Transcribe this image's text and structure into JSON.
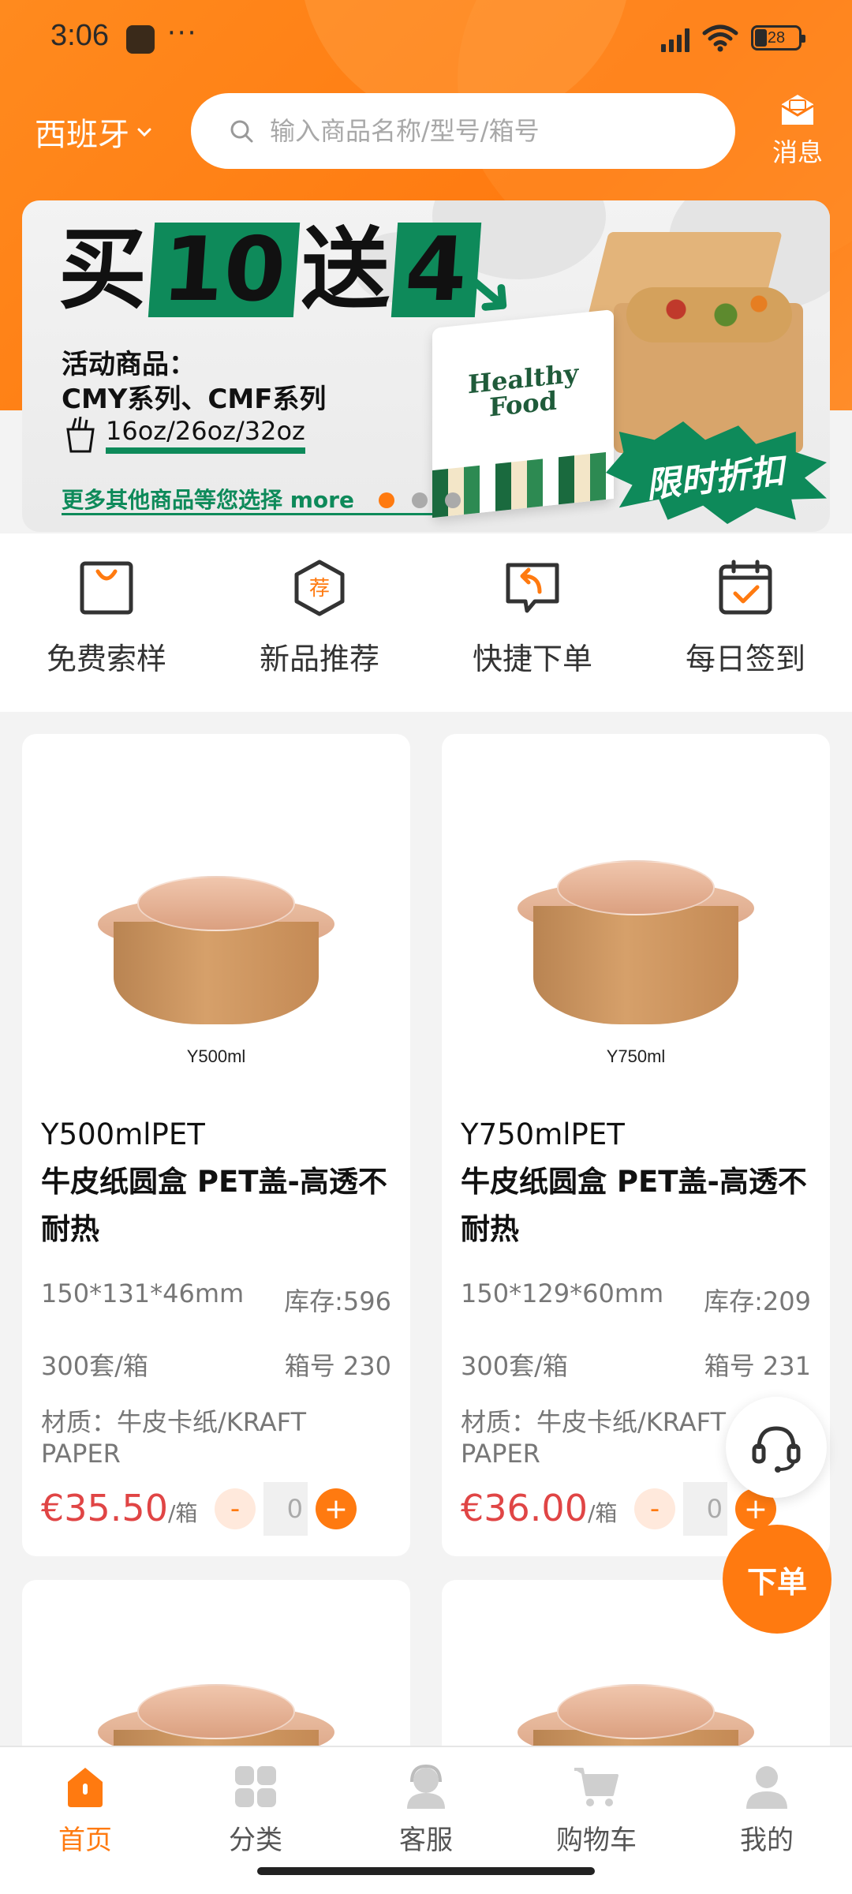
{
  "status_bar": {
    "time": "3:06",
    "battery": "28"
  },
  "header": {
    "location": "西班牙",
    "search_placeholder": "输入商品名称/型号/箱号",
    "message_label": "消息"
  },
  "banner": {
    "title_part1": "买",
    "title_part2": "10",
    "title_part3": "送",
    "title_part4": "4",
    "line1": "活动商品：",
    "line2": "CMY系列、CMF系列",
    "sizes": "16oz/26oz/32oz",
    "more": "更多其他商品等您选择 more",
    "box_text": "Healthy Food",
    "badge": "限时折扣",
    "page_count": 3,
    "active_page": 0
  },
  "quick_actions": [
    {
      "label": "免费索样",
      "icon": "bag-icon"
    },
    {
      "label": "新品推荐",
      "icon": "recommend-icon",
      "badge": "荐"
    },
    {
      "label": "快捷下单",
      "icon": "quick-order-icon"
    },
    {
      "label": "每日签到",
      "icon": "calendar-check-icon"
    }
  ],
  "products": [
    {
      "image_caption": "Y500ml",
      "name_line1": "Y500mlPET",
      "name_line2": "牛皮纸圆盒 PET盖-高透不耐热",
      "dimensions": "150*131*46mm",
      "stock": "库存:596",
      "pack": "300套/箱",
      "box_no": "箱号 230",
      "material": "材质：牛皮卡纸/KRAFT PAPER",
      "price": "€35.50",
      "price_unit": "/箱",
      "qty": "0"
    },
    {
      "image_caption": "Y750ml",
      "name_line1": "Y750mlPET",
      "name_line2": "牛皮纸圆盒 PET盖-高透不耐热",
      "dimensions": "150*129*60mm",
      "stock": "库存:209",
      "pack": "300套/箱",
      "box_no": "箱号 231",
      "material": "材质：牛皮卡纸/KRAFT PAPER",
      "price": "€36.00",
      "price_unit": "/箱",
      "qty": "0"
    }
  ],
  "fabs": {
    "order_label": "下单"
  },
  "bottom_nav": [
    {
      "label": "首页",
      "active": true
    },
    {
      "label": "分类",
      "active": false
    },
    {
      "label": "客服",
      "active": false
    },
    {
      "label": "购物车",
      "active": false
    },
    {
      "label": "我的",
      "active": false
    }
  ],
  "colors": {
    "accent": "#ff7a10",
    "price": "#e04545",
    "banner_green": "#0e8a5a"
  }
}
